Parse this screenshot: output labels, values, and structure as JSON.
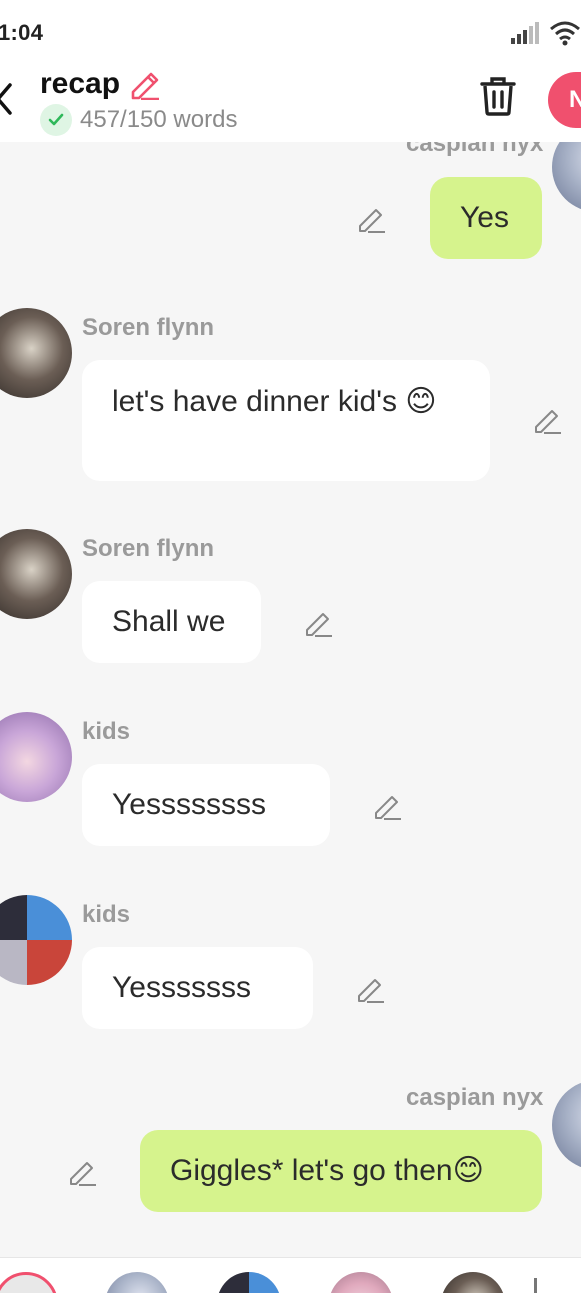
{
  "status_bar": {
    "time": "1:04"
  },
  "header": {
    "title": "recap",
    "word_count": "457/150 words",
    "new_button_label": "N"
  },
  "colors": {
    "accent": "#f0506e",
    "my_bubble": "#d6f38d",
    "their_bubble": "#ffffff",
    "background": "#f6f6f6",
    "check_green": "#2fb85a"
  },
  "messages": [
    {
      "sender": "caspian nyx",
      "text": "Yes",
      "side": "right"
    },
    {
      "sender": "Soren flynn",
      "text": "let's have dinner kid's 😊",
      "side": "left"
    },
    {
      "sender": "Soren flynn",
      "text": "Shall we",
      "side": "left"
    },
    {
      "sender": "kids",
      "text": "Yessssssss",
      "side": "left"
    },
    {
      "sender": "kids",
      "text": "Yesssssss",
      "side": "left"
    },
    {
      "sender": "caspian nyx",
      "text": "Giggles* let's go then😊",
      "side": "right"
    }
  ],
  "icons": {
    "back": "chevron-left-icon",
    "title_edit": "pencil-icon",
    "status": "check-icon",
    "delete": "trash-icon",
    "message_edit": "pencil-icon"
  }
}
